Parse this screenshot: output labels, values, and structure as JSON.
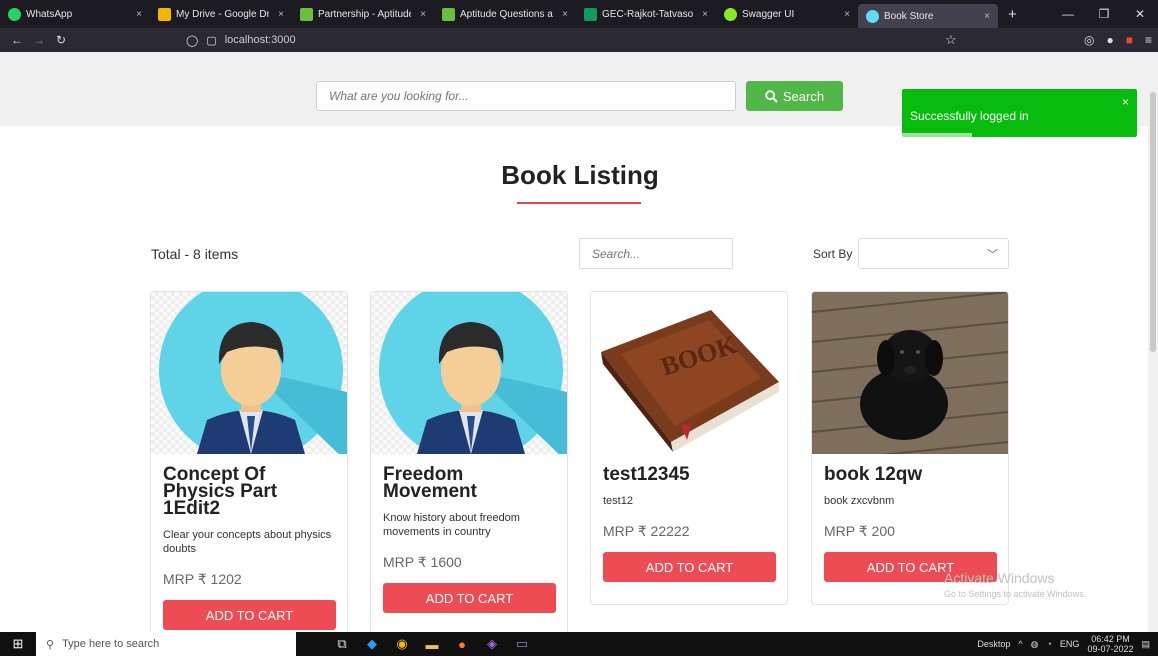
{
  "browser": {
    "tabs": [
      {
        "label": "WhatsApp",
        "icon": "whatsapp-icon",
        "color": "#25d366"
      },
      {
        "label": "My Drive - Google Drive",
        "icon": "google-drive-icon",
        "color": "#f4b400"
      },
      {
        "label": "Partnership - Aptitude Q",
        "icon": "aptitude-icon",
        "color": "#6bbf3a"
      },
      {
        "label": "Aptitude Questions and",
        "icon": "aptitude-icon",
        "color": "#6bbf3a"
      },
      {
        "label": "GEC-Rajkot-Tatvasoft_Ir",
        "icon": "sheets-icon",
        "color": "#0f9d58"
      },
      {
        "label": "Swagger UI",
        "icon": "swagger-icon",
        "color": "#85ea2d"
      },
      {
        "label": "Book Store",
        "icon": "react-icon",
        "color": "#61dafb"
      }
    ],
    "close_glyph": "×",
    "new_tab_glyph": "+",
    "url": "localhost:3000"
  },
  "search": {
    "placeholder": "What are you looking for...",
    "button_label": "Search"
  },
  "toast": {
    "message": "Successfully logged in",
    "close_glyph": "×"
  },
  "page": {
    "title": "Book Listing",
    "total": "Total - 8 items",
    "filter_placeholder": "Search...",
    "sort_label": "Sort By"
  },
  "books": [
    {
      "name": "Concept Of Physics Part 1Edit2",
      "description": "Clear your concepts about physics doubts",
      "price": "MRP ₹ 1202",
      "cta": "ADD TO CART",
      "image": "avatar-man"
    },
    {
      "name": "Freedom Movement",
      "description": "Know history about freedom movements in country",
      "price": "MRP ₹ 1600",
      "cta": "ADD TO CART",
      "image": "avatar-man"
    },
    {
      "name": "test12345",
      "description": "test12",
      "price": "MRP ₹ 22222",
      "cta": "ADD TO CART",
      "image": "book"
    },
    {
      "name": "book 12qw",
      "description": "book zxcvbnm",
      "price": "MRP ₹ 200",
      "cta": "ADD TO CART",
      "image": "dog"
    }
  ],
  "watermark": {
    "line1": "Activate Windows",
    "line2": "Go to Settings to activate Windows."
  },
  "taskbar": {
    "search_placeholder": "Type here to search",
    "desktop_label": "Desktop",
    "language": "ENG",
    "time": "06:42 PM",
    "date": "09-07-2022"
  },
  "colors": {
    "primary_red": "#ee4c55",
    "search_green": "#51b848",
    "toast_green": "#07bc0c"
  }
}
